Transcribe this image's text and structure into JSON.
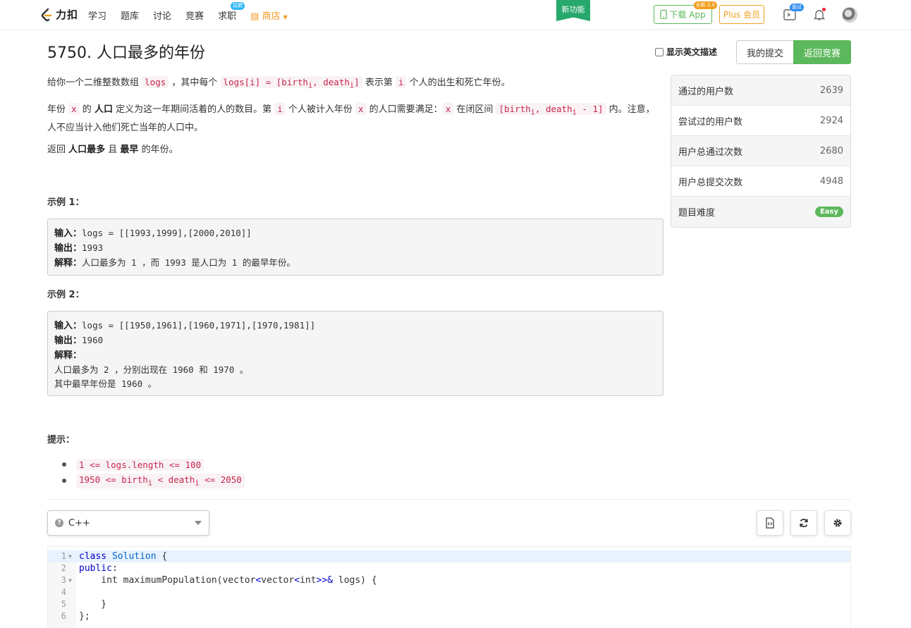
{
  "nav": {
    "logo_text": "力扣",
    "links": [
      "学习",
      "题库",
      "讨论",
      "竞赛",
      "求职",
      "商店"
    ],
    "job_badge": "招聘",
    "new_feature": "新功能",
    "download_label": "下载 App",
    "download_tag": "全新 2.0",
    "plus_label": "Plus 会员",
    "interview_badge": "面试"
  },
  "problem": {
    "title": "5750. 人口最多的年份",
    "show_english_label": "显示英文描述",
    "my_submissions_label": "我的提交",
    "back_to_contest_label": "返回竞赛",
    "desc1": {
      "a": "给你一个二维整数数组 ",
      "logs": "logs",
      "b": " ，其中每个 ",
      "logs_i": "logs[i] = [birth",
      "sub_i": "i",
      "logs_i_mid": ", death",
      "logs_i_end": "]",
      "c": " 表示第 ",
      "i": "i",
      "d": " 个人的出生和死亡年份。"
    },
    "desc2": {
      "a": "年份 ",
      "x": "x",
      "b": " 的 ",
      "bold": "人口",
      "c": " 定义为这一年期间活着的人的数目。第 ",
      "i": "i",
      "d": " 个人被计入年份 ",
      "x2": "x",
      "e": " 的人口需要满足：",
      "x3": "x",
      "f": " 在闭区间 ",
      "range_a": "[birth",
      "range_b": ", death",
      "range_c": " - 1]",
      "g": " 内。注意，人不应当计入他们死亡当年的人口中。"
    },
    "desc3": {
      "a": "返回 ",
      "bold1": "人口最多",
      "b": " 且 ",
      "bold2": "最早",
      "c": " 的年份。"
    },
    "example1_title": "示例 1：",
    "example1": {
      "input_label": "输入：",
      "input": "logs = [[1993,1999],[2000,2010]]",
      "output_label": "输出：",
      "output": "1993",
      "explain_label": "解释：",
      "explain": "人口最多为 1 ，而 1993 是人口为 1 的最早年份。"
    },
    "example2_title": "示例 2：",
    "example2": {
      "input_label": "输入：",
      "input": "logs = [[1950,1961],[1960,1971],[1970,1981]]",
      "output_label": "输出：",
      "output": "1960",
      "explain_label": "解释：",
      "explain1": "人口最多为 2 ，分别出现在 1960 和 1970 。",
      "explain2": "其中最早年份是 1960 。"
    },
    "hints_title": "提示：",
    "hint1": "1 <= logs.length <= 100",
    "hint2_a": "1950 <= birth",
    "hint2_b": " < death",
    "hint2_c": " <= 2050"
  },
  "stats": {
    "accepted_users_label": "通过的用户数",
    "accepted_users": "2639",
    "tried_users_label": "尝试过的用户数",
    "tried_users": "2924",
    "total_accepted_label": "用户总通过次数",
    "total_accepted": "2680",
    "total_submissions_label": "用户总提交次数",
    "total_submissions": "4948",
    "difficulty_label": "题目难度",
    "difficulty": "Easy"
  },
  "editor": {
    "language": "C++",
    "line_numbers": [
      "1",
      "2",
      "3",
      "4",
      "5",
      "6"
    ],
    "lines": {
      "l1_kw": "class",
      "l1_name": " Solution",
      "l1_rest": " {",
      "l2_kw": "public",
      "l2_rest": ":",
      "l3_a": "    int maximumPopulation(vector",
      "l3_b": "<",
      "l3_c": "vector",
      "l3_d": "<",
      "l3_e": "int",
      "l3_f": ">>&",
      "l3_g": " logs) {",
      "l4": "",
      "l5": "    }",
      "l6": "};"
    }
  }
}
